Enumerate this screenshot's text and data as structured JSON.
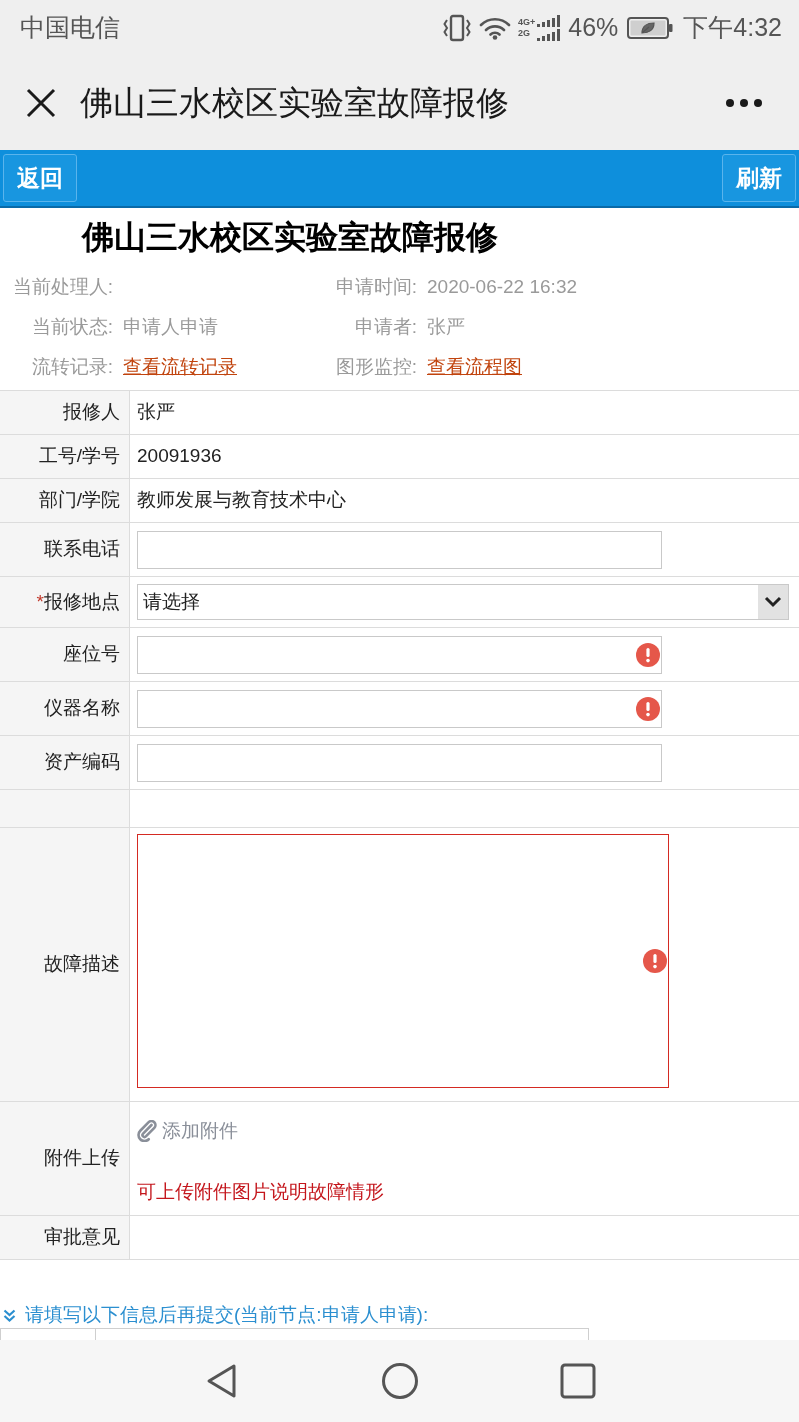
{
  "status_bar": {
    "carrier": "中国电信",
    "network": [
      "4G+",
      "2G"
    ],
    "battery": "46%",
    "time": "下午4:32"
  },
  "app_bar": {
    "title": "佛山三水校区实验室故障报修"
  },
  "toolbar": {
    "back": "返回",
    "refresh": "刷新"
  },
  "form": {
    "title": "佛山三水校区实验室故障报修",
    "meta": [
      {
        "label": "当前处理人:",
        "kind": "text"
      },
      {
        "label": "申请时间:",
        "kind": "text",
        "value": "2020-06-22 16:32"
      },
      {
        "label": "当前状态:",
        "kind": "text",
        "value": "申请人申请"
      },
      {
        "label": "申请者:",
        "kind": "text",
        "value": "张严"
      },
      {
        "label": "流转记录:",
        "kind": "link",
        "value": "查看流转记录"
      },
      {
        "label": "图形监控:",
        "kind": "link",
        "value": "查看流程图"
      }
    ],
    "fields": [
      {
        "kind": "text",
        "label": "报修人",
        "value": "张严"
      },
      {
        "kind": "text",
        "label": "工号/学号",
        "value": "20091936"
      },
      {
        "kind": "text",
        "label": "部门/学院",
        "value": "教师发展与教育技术中心"
      },
      {
        "kind": "input",
        "label": "联系电话",
        "error": false
      },
      {
        "kind": "select",
        "label": "报修地点",
        "marker": "*",
        "value": "请选择"
      },
      {
        "kind": "input",
        "label": "座位号",
        "error": true
      },
      {
        "kind": "input",
        "label": "仪器名称",
        "error": true
      },
      {
        "kind": "input",
        "label": "资产编码",
        "error": false
      },
      {
        "kind": "blank"
      },
      {
        "kind": "textarea",
        "label": "故障描述",
        "error": true
      },
      {
        "kind": "attachment",
        "label": "附件上传",
        "action": "添加附件",
        "hint": "可上传附件图片说明故障情形"
      },
      {
        "kind": "text",
        "label": "审批意见"
      }
    ]
  },
  "next_section": {
    "title": "请填写以下信息后再提交(当前节点:申请人申请):"
  }
}
